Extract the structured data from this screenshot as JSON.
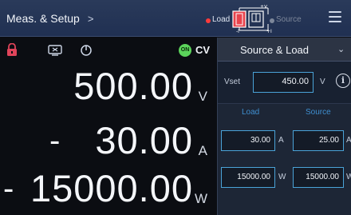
{
  "header": {
    "breadcrumb_title": "Meas. & Setup",
    "chevron": ">",
    "load_label": "Load",
    "source_label": "Source",
    "flow_voltage_label": "+V",
    "load_dot_color": "#ff3b3b",
    "source_dot_color": "#7d879a"
  },
  "status": {
    "cv_badge": "ON",
    "cv_mode": "CV"
  },
  "readouts": {
    "voltage": {
      "value": "500.00",
      "unit": "V"
    },
    "current": {
      "sign": "-",
      "value": "30.00",
      "unit": "A"
    },
    "power": {
      "sign": "-",
      "value": "15000.00",
      "unit": "W"
    }
  },
  "mode_panel": {
    "mode_label": "Source & Load",
    "dropdown_icon": "chevron-down-icon",
    "vset_label": "Vset",
    "vset_value": "450.00",
    "vset_unit": "V",
    "columns": {
      "load_header": "Load",
      "source_header": "Source"
    },
    "load": {
      "current_value": "30.00",
      "current_unit": "A",
      "power_value": "15000.00",
      "power_unit": "W"
    },
    "source": {
      "current_value": "25.00",
      "current_unit": "A",
      "power_value": "15000.00",
      "power_unit": "W"
    }
  },
  "colors": {
    "accent": "#4aa3d8",
    "column_header": "#3f8fd0",
    "cv_on": "#5bd35b",
    "lock": "#e0445a"
  }
}
